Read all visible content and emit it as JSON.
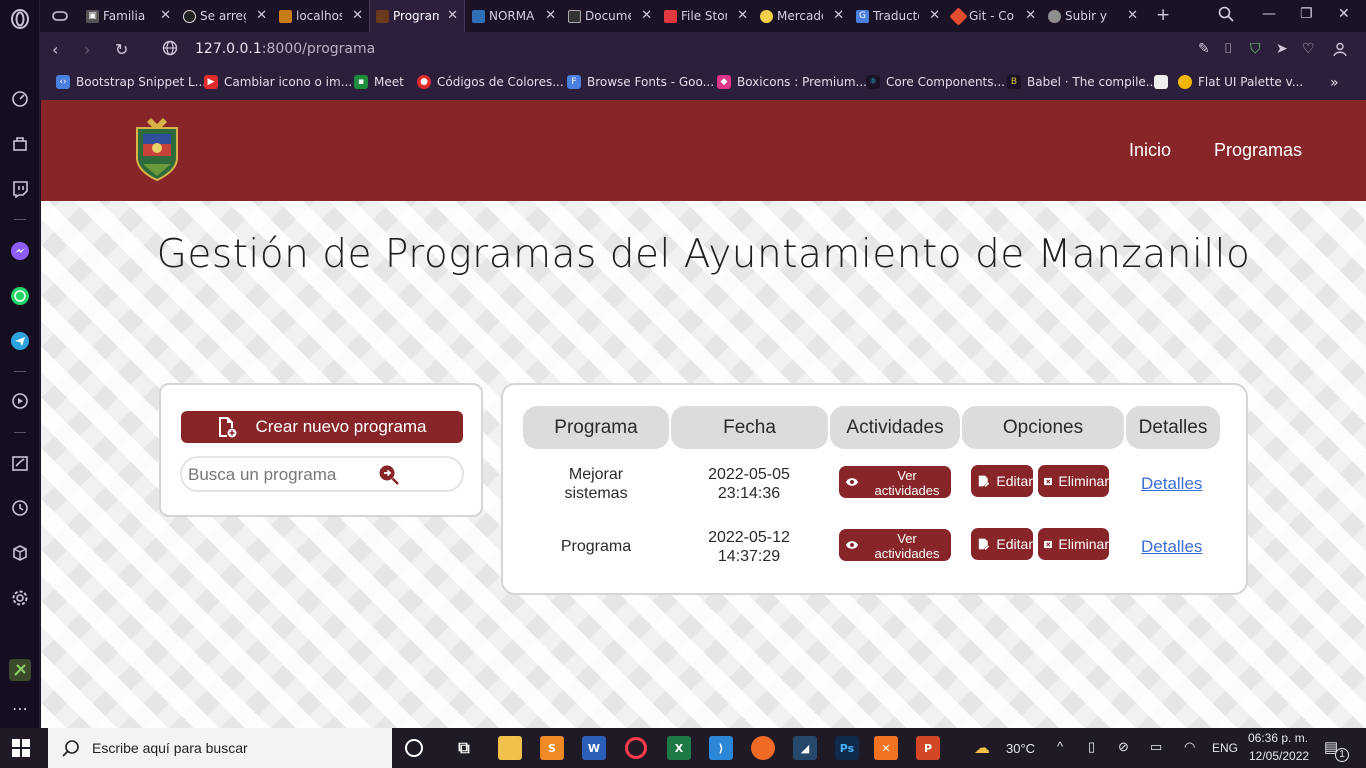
{
  "browser": {
    "tabs": [
      {
        "title": "Familia",
        "color": "#555"
      },
      {
        "title": "Se arreg",
        "color": "#222"
      },
      {
        "title": "localhost",
        "color": "#c77b1b"
      },
      {
        "title": "Program",
        "color": "#6b3a1c"
      },
      {
        "title": "NORMA",
        "color": "#2f6fb5"
      },
      {
        "title": "Docume",
        "color": "#333"
      },
      {
        "title": "File Stor",
        "color": "#e0383e"
      },
      {
        "title": "Mercado",
        "color": "#f3d14a"
      },
      {
        "title": "Traducto",
        "color": "#4a7fe0"
      },
      {
        "title": "Git - Co",
        "color": "#e44c2f"
      },
      {
        "title": "Subir y",
        "color": "#8e8e8e"
      }
    ],
    "url_host": "127.0.0.1",
    "url_rest": ":8000/programa",
    "bookmarks": [
      {
        "label": "Bootstrap Snippet L...",
        "color": "#4a7fe0"
      },
      {
        "label": "Cambiar icono o im...",
        "color": "#e02c2c"
      },
      {
        "label": "Meet",
        "color": "#1e8e3e"
      },
      {
        "label": "Códigos de Colores...",
        "color": "#e02c2c"
      },
      {
        "label": "Browse Fonts - Goo...",
        "color": "#4a7fe0"
      },
      {
        "label": "Boxicons : Premium...",
        "color": "#e0368a"
      },
      {
        "label": "Core Components...",
        "color": "#2bbbd8"
      },
      {
        "label": "Babel · The compile...",
        "color": "#d8c62b"
      },
      {
        "label": "",
        "color": "#eeeeee"
      },
      {
        "label": "Flat UI Palette v...",
        "color": "#f2b705"
      }
    ]
  },
  "site": {
    "nav": {
      "inicio": "Inicio",
      "programas": "Programas"
    },
    "title": "Gestión de Programas del Ayuntamiento de Manzanillo",
    "create_button": "Crear nuevo programa",
    "search_placeholder": "Busca un programa",
    "table": {
      "headers": [
        "Programa",
        "Fecha",
        "Actividades",
        "Opciones",
        "Detalles"
      ],
      "rows": [
        {
          "programa": "Mejorar sistemas",
          "fecha": "2022-05-05 23:14:36",
          "actividades": "Ver actividades",
          "editar": "Editar",
          "eliminar": "Eliminar",
          "detalles": "Detalles"
        },
        {
          "programa": "Programa",
          "fecha": "2022-05-12 14:37:29",
          "actividades": "Ver actividades",
          "editar": "Editar",
          "eliminar": "Eliminar",
          "detalles": "Detalles"
        }
      ]
    },
    "brand_color": "#872528"
  },
  "taskbar": {
    "search_placeholder": "Escribe aquí para buscar",
    "weather": "30°C",
    "lang": "ENG",
    "time": "06:36 p. m.",
    "date": "12/05/2022",
    "notifications": "1"
  }
}
